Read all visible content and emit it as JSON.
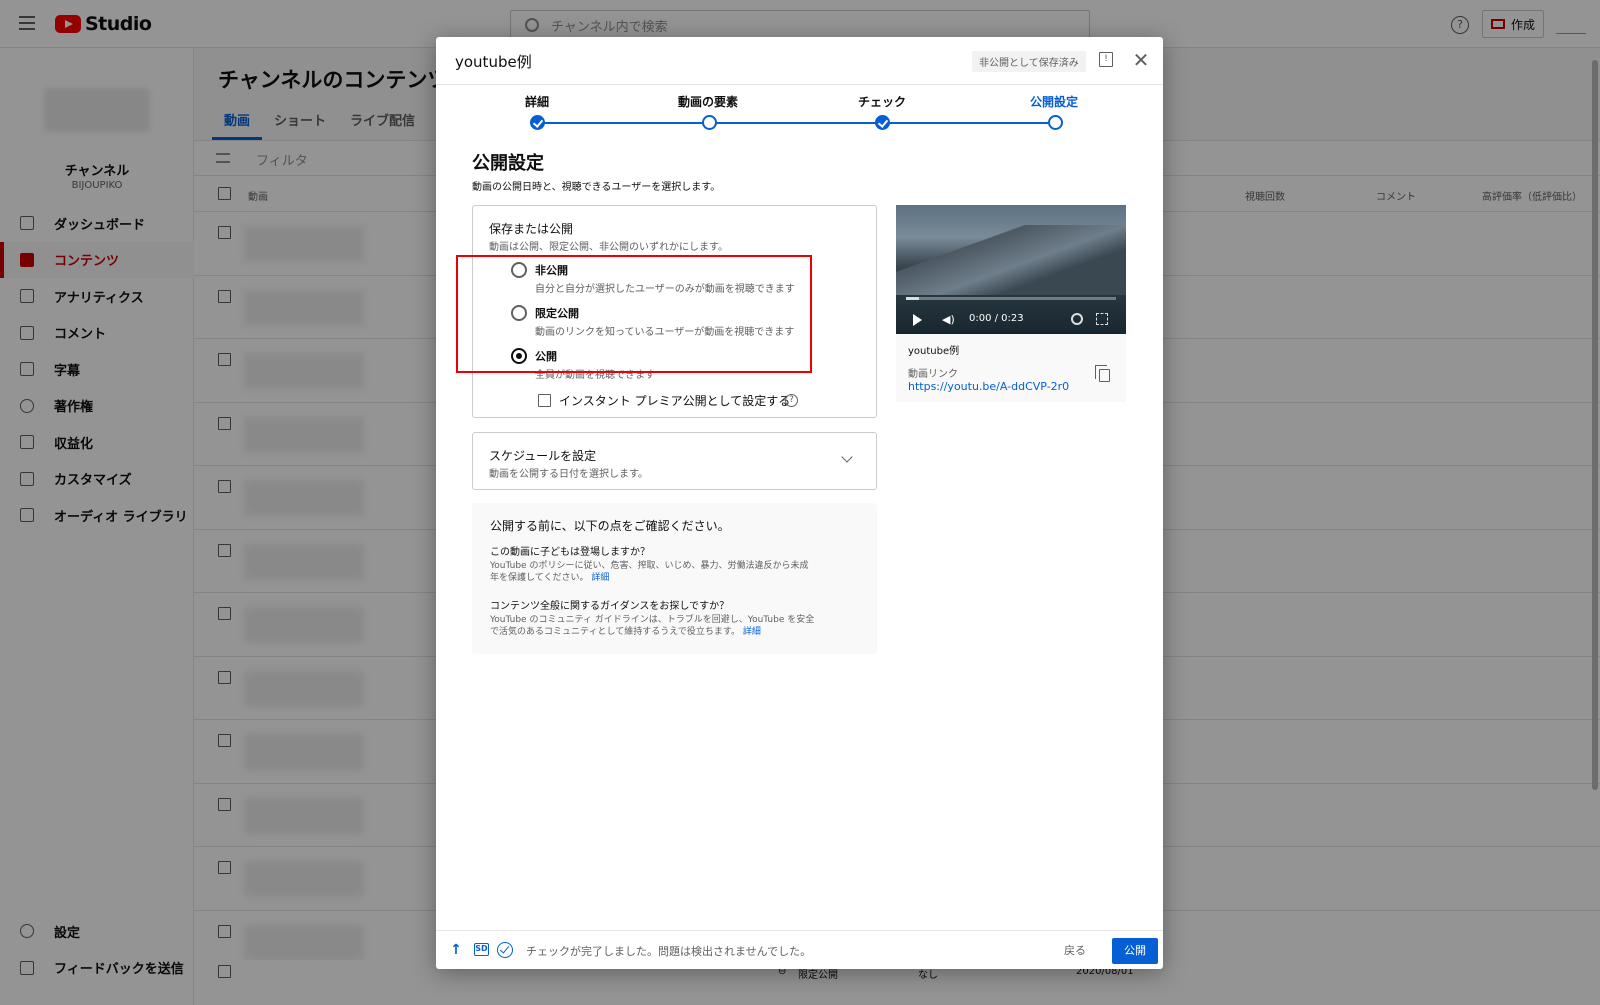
{
  "studio": {
    "logo_text": "Studio",
    "search_placeholder": "チャンネル内で検索",
    "help_label": "?",
    "create_label": "作成",
    "channel_name": "チャンネル",
    "channel_handle": "BIJOUPIKO",
    "title": "チャンネルのコンテンツ",
    "tabs": [
      {
        "label": "動画",
        "active": true
      },
      {
        "label": "ショート",
        "active": false
      },
      {
        "label": "ライブ配信",
        "active": false
      }
    ],
    "filter_label": "フィルタ",
    "columns": [
      "動画",
      "視聴回数",
      "コメント",
      "高評価率（低評価比）"
    ],
    "nav": [
      {
        "label": "ダッシュボード",
        "icon": "dashboard-icon",
        "active": false
      },
      {
        "label": "コンテンツ",
        "icon": "content-icon",
        "active": true
      },
      {
        "label": "アナリティクス",
        "icon": "analytics-icon",
        "active": false
      },
      {
        "label": "コメント",
        "icon": "comments-icon",
        "active": false
      },
      {
        "label": "字幕",
        "icon": "subtitles-icon",
        "active": false
      },
      {
        "label": "著作権",
        "icon": "copyright-icon",
        "active": false
      },
      {
        "label": "収益化",
        "icon": "monetization-icon",
        "active": false
      },
      {
        "label": "カスタマイズ",
        "icon": "customize-icon",
        "active": false
      },
      {
        "label": "オーディオ ライブラリ",
        "icon": "audio-library-icon",
        "active": false
      }
    ],
    "nav_bottom": [
      {
        "label": "設定",
        "icon": "settings-icon"
      },
      {
        "label": "フィードバックを送信",
        "icon": "feedback-icon"
      }
    ],
    "last_row": {
      "visibility": "限定公開",
      "restriction": "なし",
      "date": "2020/08/01"
    }
  },
  "dialog": {
    "title": "youtube例",
    "saved_badge": "非公開として保存済み",
    "steps": [
      {
        "label": "詳細",
        "state": "done"
      },
      {
        "label": "動画の要素",
        "state": "visited"
      },
      {
        "label": "チェック",
        "state": "done"
      },
      {
        "label": "公開設定",
        "state": "current"
      }
    ],
    "section_title": "公開設定",
    "section_sub": "動画の公開日時と、視聴できるユーザーを選択します。",
    "save_box": {
      "title": "保存または公開",
      "sub": "動画は公開、限定公開、非公開のいずれかにします。",
      "options": [
        {
          "label": "非公開",
          "desc": "自分と自分が選択したユーザーのみが動画を視聴できます",
          "selected": false
        },
        {
          "label": "限定公開",
          "desc": "動画のリンクを知っているユーザーが動画を視聴できます",
          "selected": false
        },
        {
          "label": "公開",
          "desc": "全員が動画を視聴できます",
          "selected": true
        }
      ],
      "premiere_label": "インスタント プレミア公開として設定する",
      "premiere_checked": false
    },
    "schedule": {
      "title": "スケジュールを設定",
      "sub": "動画を公開する日付を選択します。"
    },
    "notice": {
      "heading": "公開する前に、以下の点をご確認ください。",
      "q1": "この動画に子どもは登場しますか？",
      "p1": "YouTube のポリシーに従い、危害、搾取、いじめ、暴力、労働法違反から未成年を保護してください。",
      "q2": "コンテンツ全般に関するガイダンスをお探しですか？",
      "p2": "YouTube のコミュニティ ガイドラインは、トラブルを回避し、YouTube を安全で活気のあるコミュニティとして維持するうえで役立ちます。",
      "link": "詳細"
    },
    "video": {
      "time": "0:00 / 0:23",
      "title": "youtube例",
      "link_label": "動画リンク",
      "url": "https://youtu.be/A-ddCVP-2r0",
      "progress": 0.06
    },
    "footer": {
      "sd_badge": "SD",
      "status": "チェックが完了しました。問題は検出されませんでした。",
      "back": "戻る",
      "publish": "公開"
    }
  },
  "colors": {
    "accent": "#065fd4",
    "brand_red": "#ff0000",
    "highlight_box": "#ee0000"
  }
}
